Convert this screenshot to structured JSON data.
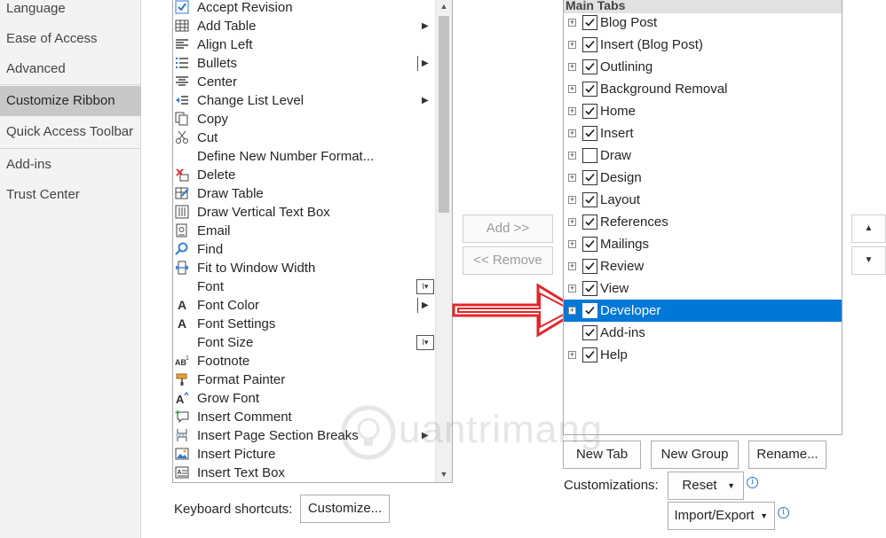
{
  "nav": {
    "items": [
      {
        "label": "Language"
      },
      {
        "label": "Ease of Access"
      },
      {
        "label": "Advanced"
      },
      {
        "label": "Customize Ribbon"
      },
      {
        "label": "Quick Access Toolbar"
      },
      {
        "label": "Add-ins"
      },
      {
        "label": "Trust Center"
      }
    ],
    "selected": "Customize Ribbon"
  },
  "commands": {
    "items": [
      {
        "label": "Accept Revision",
        "icon": "checkbox-check-icon"
      },
      {
        "label": "Add Table",
        "icon": "table-icon",
        "indicator": "submenu"
      },
      {
        "label": "Align Left",
        "icon": "align-left-icon"
      },
      {
        "label": "Bullets",
        "icon": "bullets-icon",
        "indicator": "split"
      },
      {
        "label": "Center",
        "icon": "align-center-icon"
      },
      {
        "label": "Change List Level",
        "icon": "list-level-icon",
        "indicator": "submenu"
      },
      {
        "label": "Copy",
        "icon": "copy-icon"
      },
      {
        "label": "Cut",
        "icon": "scissors-icon"
      },
      {
        "label": "Define New Number Format...",
        "icon": ""
      },
      {
        "label": "Delete",
        "icon": "delete-icon"
      },
      {
        "label": "Draw Table",
        "icon": "draw-table-icon"
      },
      {
        "label": "Draw Vertical Text Box",
        "icon": "vertical-textbox-icon"
      },
      {
        "label": "Email",
        "icon": "email-icon"
      },
      {
        "label": "Find",
        "icon": "find-icon"
      },
      {
        "label": "Fit to Window Width",
        "icon": "fit-width-icon"
      },
      {
        "label": "Font",
        "icon": "",
        "indicator": "combo"
      },
      {
        "label": "Font Color",
        "icon": "font-color-icon",
        "indicator": "split"
      },
      {
        "label": "Font Settings",
        "icon": "font-settings-icon"
      },
      {
        "label": "Font Size",
        "icon": "",
        "indicator": "combo"
      },
      {
        "label": "Footnote",
        "icon": "footnote-icon"
      },
      {
        "label": "Format Painter",
        "icon": "format-painter-icon"
      },
      {
        "label": "Grow Font",
        "icon": "grow-font-icon"
      },
      {
        "label": "Insert Comment",
        "icon": "insert-comment-icon"
      },
      {
        "label": "Insert Page  Section Breaks",
        "icon": "page-break-icon",
        "indicator": "submenu"
      },
      {
        "label": "Insert Picture",
        "icon": "picture-icon"
      },
      {
        "label": "Insert Text Box",
        "icon": "textbox-icon"
      }
    ]
  },
  "buttons": {
    "add": "Add >>",
    "remove": "<< Remove",
    "new_tab": "New Tab",
    "new_group": "New Group",
    "rename": "Rename...",
    "reset": "Reset",
    "import_export": "Import/Export",
    "customize": "Customize...",
    "move_up": "▲",
    "move_down": "▼"
  },
  "labels": {
    "keyboard_shortcuts": "Keyboard shortcuts:",
    "customizations": "Customizations:"
  },
  "main_tabs": {
    "header": "Main Tabs",
    "items": [
      {
        "label": "Blog Post",
        "checked": true,
        "expandable": true
      },
      {
        "label": "Insert (Blog Post)",
        "checked": true,
        "expandable": true
      },
      {
        "label": "Outlining",
        "checked": true,
        "expandable": true
      },
      {
        "label": "Background Removal",
        "checked": true,
        "expandable": true
      },
      {
        "label": "Home",
        "checked": true,
        "expandable": true
      },
      {
        "label": "Insert",
        "checked": true,
        "expandable": true
      },
      {
        "label": "Draw",
        "checked": false,
        "expandable": true
      },
      {
        "label": "Design",
        "checked": true,
        "expandable": true
      },
      {
        "label": "Layout",
        "checked": true,
        "expandable": true
      },
      {
        "label": "References",
        "checked": true,
        "expandable": true
      },
      {
        "label": "Mailings",
        "checked": true,
        "expandable": true
      },
      {
        "label": "Review",
        "checked": true,
        "expandable": true
      },
      {
        "label": "View",
        "checked": true,
        "expandable": true
      },
      {
        "label": "Developer",
        "checked": true,
        "expandable": true,
        "selected": true
      },
      {
        "label": "Add-ins",
        "checked": true,
        "expandable": false
      },
      {
        "label": "Help",
        "checked": true,
        "expandable": true
      }
    ]
  },
  "watermark": {
    "text": "uantrimang"
  },
  "colors": {
    "selection": "#0078d7",
    "arrow": "#e3262b"
  }
}
